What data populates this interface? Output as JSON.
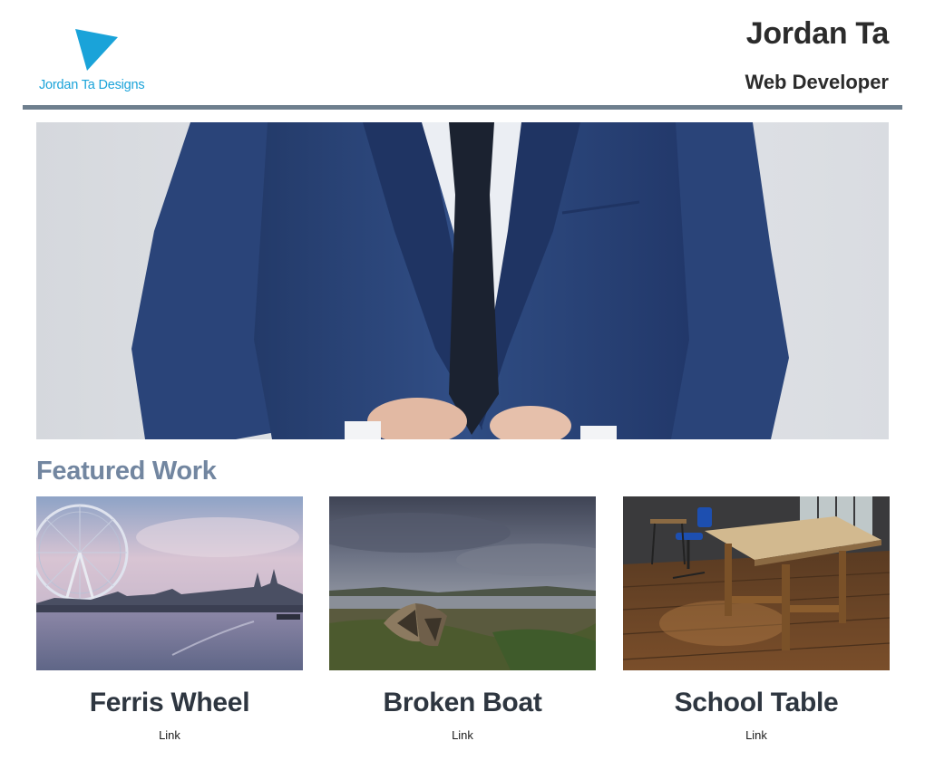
{
  "header": {
    "logo_text": "Jordan Ta Designs",
    "name": "Jordan Ta",
    "role": "Web Developer"
  },
  "hero": {
    "image_icon": "suit-photo"
  },
  "featured": {
    "title": "Featured Work",
    "items": [
      {
        "title": "Ferris Wheel",
        "link_label": "Link",
        "image_icon": "ferris-wheel-photo"
      },
      {
        "title": "Broken Boat",
        "link_label": "Link",
        "image_icon": "broken-boat-photo"
      },
      {
        "title": "School Table",
        "link_label": "Link",
        "image_icon": "school-table-photo"
      }
    ]
  },
  "colors": {
    "brand_blue": "#1aa3d9",
    "header_rule": "#6e7f8e",
    "section_title": "#7286a0",
    "suit_navy": "#2c4476"
  }
}
